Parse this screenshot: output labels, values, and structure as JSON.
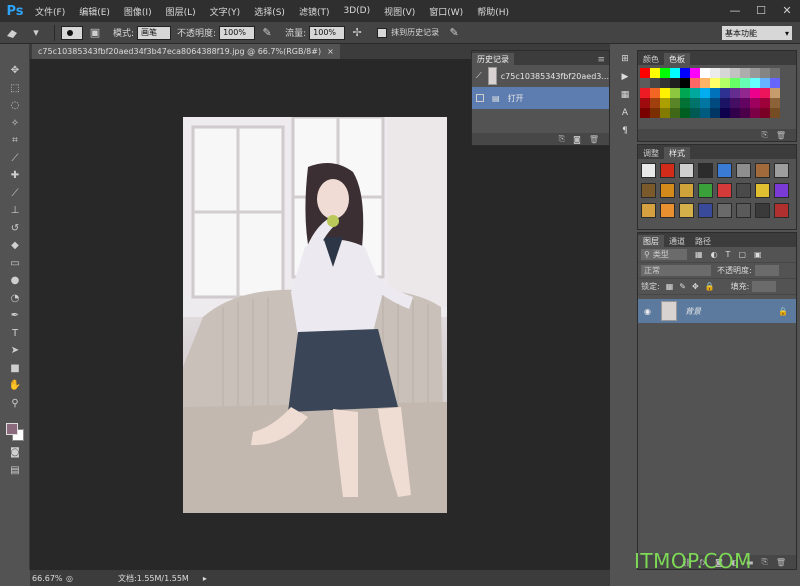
{
  "menubar": {
    "logo": "Ps",
    "items": [
      "文件(F)",
      "编辑(E)",
      "图像(I)",
      "图层(L)",
      "文字(Y)",
      "选择(S)",
      "滤镜(T)",
      "3D(D)",
      "视图(V)",
      "窗口(W)",
      "帮助(H)"
    ],
    "window_controls": [
      "—",
      "☐",
      "✕"
    ]
  },
  "options": {
    "mode_label": "模式:",
    "mode_value": "画笔",
    "opacity_label": "不透明度:",
    "opacity_value": "100%",
    "flow_label": "流量:",
    "flow_value": "100%",
    "erase_history_label": "抹到历史记录",
    "workspace": "基本功能"
  },
  "document": {
    "tab_title": "c75c10385343fbf20aed34f3b47eca8064388f19.jpg @ 66.7%(RGB/8#)",
    "zoom": "66.67%",
    "doc_size": "文档:1.55M/1.55M"
  },
  "history_panel": {
    "tab_label": "历史记录",
    "snapshot_label": "c75c10385343fbf20aed3...",
    "step_label": "打开"
  },
  "swatches_panel": {
    "tabs": [
      "颜色",
      "色板"
    ],
    "colors": [
      "#ff0000",
      "#ffff00",
      "#00ff00",
      "#00ffff",
      "#0000ff",
      "#ff00ff",
      "#ffffff",
      "#ebebeb",
      "#d6d6d6",
      "#c2c2c2",
      "#adadad",
      "#999999",
      "#858585",
      "#707070",
      "#5c5c5c",
      "#474747",
      "#333333",
      "#1f1f1f",
      "#000000",
      "#ff6666",
      "#ffb366",
      "#ffff66",
      "#b3ff66",
      "#66ff66",
      "#66ffb3",
      "#66ffff",
      "#66b3ff",
      "#6666ff",
      "#ed1c24",
      "#f26522",
      "#fff200",
      "#8dc63f",
      "#00a651",
      "#00a99d",
      "#00aeef",
      "#0072bc",
      "#2e3192",
      "#662d91",
      "#92278f",
      "#ec008c",
      "#ed145b",
      "#c69c6d",
      "#9e0b0f",
      "#a0410d",
      "#aba000",
      "#598527",
      "#007236",
      "#00746b",
      "#0076a3",
      "#004a80",
      "#1b1464",
      "#440e62",
      "#630460",
      "#9e005d",
      "#9e0039",
      "#8c6239",
      "#790000",
      "#7b2e00",
      "#827b00",
      "#406618",
      "#005e20",
      "#005952",
      "#005b7f",
      "#003663",
      "#0d004c",
      "#32004b",
      "#4b0049",
      "#7b0046",
      "#7a0026",
      "#754c24"
    ]
  },
  "styles_panel": {
    "tabs": [
      "调整",
      "样式"
    ],
    "styles": [
      "#e9e9e9",
      "#d22b1a",
      "#cfcfcf",
      "#2c2c2c",
      "#3a7bd5",
      "#8e8e8e",
      "#a26a3a",
      "#9e9e9e",
      "#7a5a2a",
      "#d48a1a",
      "#cfa23a",
      "#3aa03a",
      "#d43a3a",
      "#4a4a4a",
      "#e0c030",
      "#7a3ad5",
      "#d4a040",
      "#e89030",
      "#d4b04a",
      "#3a4a9a",
      "#6a6a6a",
      "#5a5a5a",
      "#3a3a3a",
      "#b03030"
    ]
  },
  "layers_panel": {
    "tabs": [
      "图层",
      "通道",
      "路径"
    ],
    "kind_label": "类型",
    "blend_mode": "正常",
    "opacity_label": "不透明度:",
    "lock_label": "锁定:",
    "fill_label": "填充:",
    "layer_name": "背景"
  },
  "watermark": "ITMOP.COM"
}
